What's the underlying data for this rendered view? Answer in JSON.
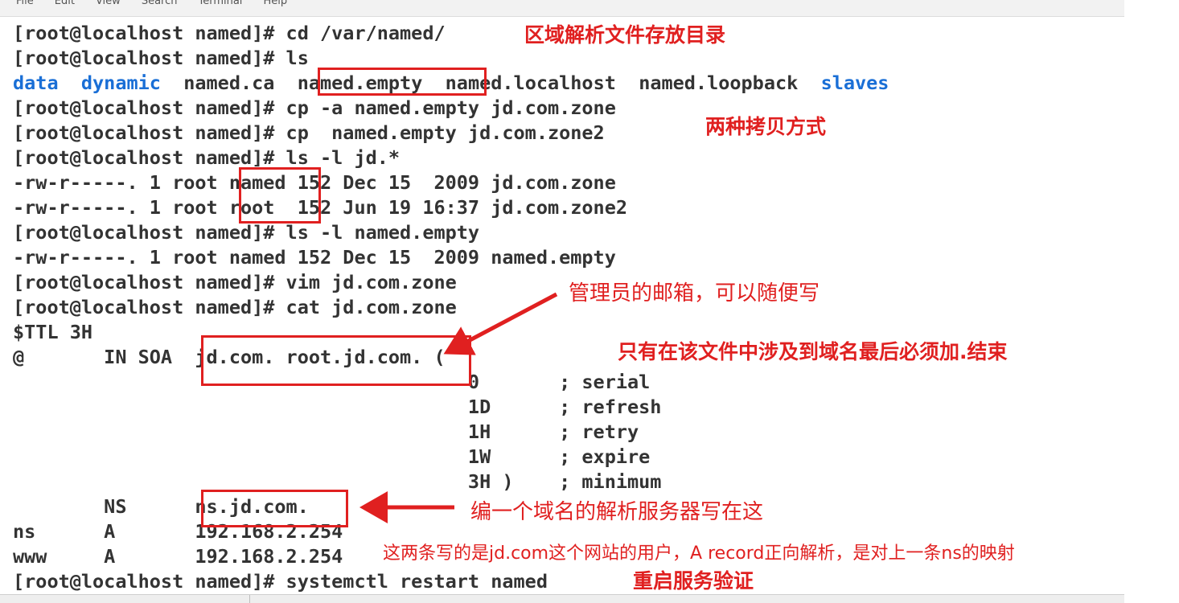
{
  "menu": [
    "File",
    "Edit",
    "View",
    "Search",
    "Terminal",
    "Help"
  ],
  "terminal": {
    "l1": "[root@localhost named]# cd /var/named/",
    "l2": "[root@localhost named]# ls",
    "ls": {
      "dir1": "data",
      "dir2": "dynamic",
      "f1": "named.ca",
      "f2": "named.empty",
      "f3": "named.localhost",
      "f4": "named.loopback",
      "dir3": "slaves"
    },
    "l4": "[root@localhost named]# cp -a named.empty jd.com.zone",
    "l5": "[root@localhost named]# cp  named.empty jd.com.zone2",
    "l6": "[root@localhost named]# ls -l jd.*",
    "l7": "-rw-r-----. 1 root named 152 Dec 15  2009 jd.com.zone",
    "l8": "-rw-r-----. 1 root root  152 Jun 19 16:37 jd.com.zone2",
    "l9": "[root@localhost named]# ls -l named.empty",
    "l10": "-rw-r-----. 1 root named 152 Dec 15  2009 named.empty",
    "l11": "[root@localhost named]# vim jd.com.zone",
    "l12": "[root@localhost named]# cat jd.com.zone",
    "l13": "$TTL 3H",
    "l14": "@       IN SOA  jd.com. root.jd.com. (",
    "l15": "                                        0       ; serial",
    "l16": "                                        1D      ; refresh",
    "l17": "                                        1H      ; retry",
    "l18": "                                        1W      ; expire",
    "l19": "                                        3H )    ; minimum",
    "l20": "        NS      ns.jd.com.",
    "l21": "ns      A       192.168.2.254",
    "l22": "www     A       192.168.2.254",
    "l23": "[root@localhost named]# systemctl restart named"
  },
  "notes": {
    "n1": "区域解析文件存放目录",
    "n2": "两种拷贝方式",
    "n3": "管理员的邮箱，可以随便写",
    "n4": "只有在该文件中涉及到域名最后必须加.结束",
    "n5": "编一个域名的解析服务器写在这",
    "n6": "这两条写的是jd.com这个网站的用户，A record正向解析，是对上一条ns的映射",
    "n7": "重启服务验证"
  },
  "colors": {
    "annotation": "#e02020",
    "directory": "#1a6fd6",
    "text": "#333333"
  }
}
